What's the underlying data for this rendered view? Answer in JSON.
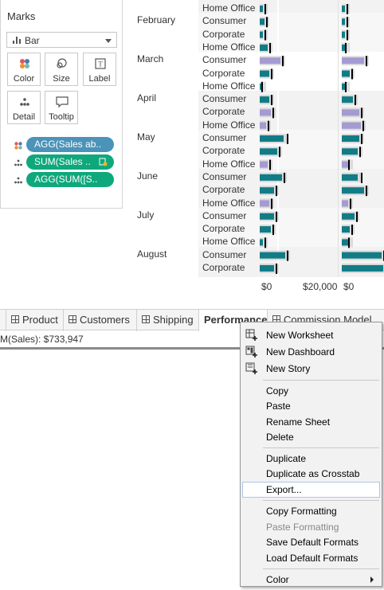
{
  "marks_card": {
    "title": "Marks",
    "mark_type": "Bar",
    "buttons": [
      {
        "label": "Color",
        "icon": "color-dots-icon"
      },
      {
        "label": "Size",
        "icon": "size-icon"
      },
      {
        "label": "Label",
        "icon": "label-icon"
      },
      {
        "label": "Detail",
        "icon": "detail-icon"
      },
      {
        "label": "Tooltip",
        "icon": "tooltip-icon"
      }
    ],
    "pills": [
      {
        "text": "AGG(Sales ab..",
        "color": "#4b93b8",
        "icon": "color-dots-icon"
      },
      {
        "text": "SUM(Sales ..",
        "color": "#0fa87c",
        "icon": "detail-icon"
      },
      {
        "text": "AGG(SUM([S..",
        "color": "#0fa87c",
        "icon": "detail-icon"
      }
    ]
  },
  "chart": {
    "months": [
      "February",
      "March",
      "April",
      "May",
      "June",
      "July",
      "August"
    ],
    "segments": [
      "Home Office",
      "Consumer",
      "Corporate",
      "Home Office",
      "Consumer",
      "Corporate",
      "Home Office",
      "Consumer",
      "Corporate",
      "Home Office",
      "Consumer",
      "Corporate",
      "Home Office",
      "Consumer",
      "Corporate",
      "Home Office",
      "Consumer",
      "Corporate",
      "Home Office",
      "Consumer",
      "Corporate",
      "Home Office",
      "Consumer",
      "Corporate"
    ],
    "ticks": [
      "$0",
      "$20,000",
      "$0"
    ],
    "colors": {
      "teal": "#127c86",
      "lavender": "#a59ad1",
      "grey": "#c8c8c8",
      "reference": "#000000"
    }
  },
  "tabs": [
    "Product",
    "Customers",
    "Shipping",
    "Performance",
    "Commission Model"
  ],
  "active_tab": "Performance",
  "status_text": "M(Sales): $733,947",
  "context_menu": {
    "items": [
      {
        "label": "New Worksheet",
        "icon": "new-worksheet-icon"
      },
      {
        "label": "New Dashboard",
        "icon": "new-dashboard-icon"
      },
      {
        "label": "New Story",
        "icon": "new-story-icon"
      },
      {
        "label": "Copy"
      },
      {
        "label": "Paste"
      },
      {
        "label": "Rename Sheet"
      },
      {
        "label": "Delete"
      },
      {
        "label": "Duplicate"
      },
      {
        "label": "Duplicate as Crosstab"
      },
      {
        "label": "Export..."
      },
      {
        "label": "Copy Formatting"
      },
      {
        "label": "Paste Formatting",
        "disabled": true
      },
      {
        "label": "Save Default Formats"
      },
      {
        "label": "Load Default Formats"
      },
      {
        "label": "Color",
        "submenu": true
      }
    ],
    "highlighted": "Export..."
  }
}
